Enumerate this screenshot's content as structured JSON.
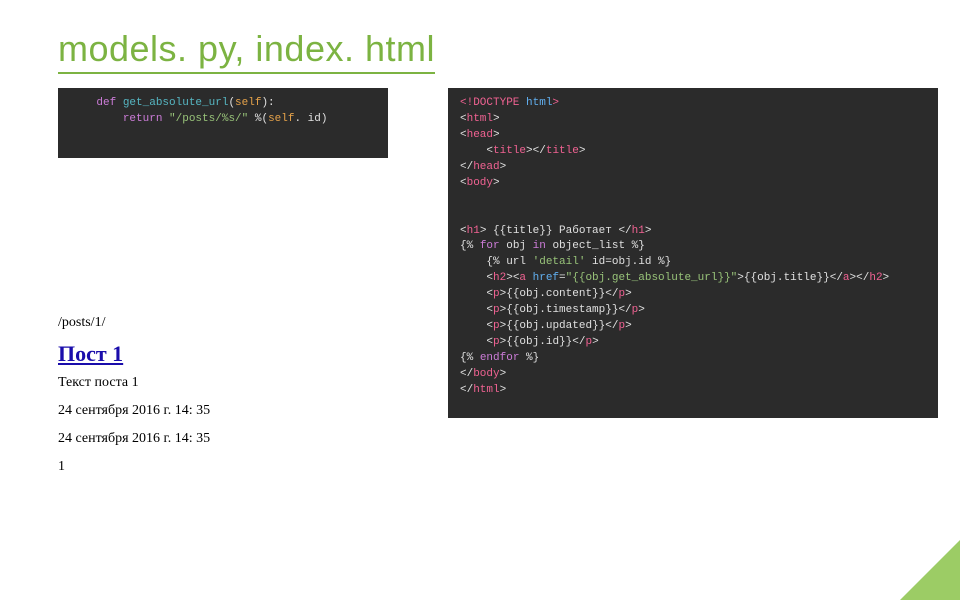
{
  "title": "models. py, index. html",
  "code_left": {
    "tokens": [
      {
        "t": "    ",
        "c": ""
      },
      {
        "t": "def ",
        "c": "kw-purple"
      },
      {
        "t": "get_absolute_url",
        "c": "kw-cyan"
      },
      {
        "t": "(",
        "c": "kw-white"
      },
      {
        "t": "self",
        "c": "kw-orange"
      },
      {
        "t": "):",
        "c": "kw-white"
      },
      {
        "t": "\n",
        "c": ""
      },
      {
        "t": "        ",
        "c": ""
      },
      {
        "t": "return ",
        "c": "kw-purple"
      },
      {
        "t": "\"/posts/%s/\"",
        "c": "kw-green"
      },
      {
        "t": " %(",
        "c": "kw-white"
      },
      {
        "t": "self",
        "c": "kw-orange"
      },
      {
        "t": ". id)",
        "c": "kw-white"
      }
    ]
  },
  "code_right": {
    "tokens": [
      {
        "t": "<!DOCTYPE ",
        "c": "kw-pink"
      },
      {
        "t": "html",
        "c": "kw-lightblue"
      },
      {
        "t": ">",
        "c": "kw-pink"
      },
      {
        "t": "\n",
        "c": ""
      },
      {
        "t": "<",
        "c": "kw-white"
      },
      {
        "t": "html",
        "c": "kw-pink"
      },
      {
        "t": ">",
        "c": "kw-white"
      },
      {
        "t": "\n",
        "c": ""
      },
      {
        "t": "<",
        "c": "kw-white"
      },
      {
        "t": "head",
        "c": "kw-pink"
      },
      {
        "t": ">",
        "c": "kw-white"
      },
      {
        "t": "\n",
        "c": ""
      },
      {
        "t": "    <",
        "c": "kw-white"
      },
      {
        "t": "title",
        "c": "kw-pink"
      },
      {
        "t": "></",
        "c": "kw-white"
      },
      {
        "t": "title",
        "c": "kw-pink"
      },
      {
        "t": ">",
        "c": "kw-white"
      },
      {
        "t": "\n",
        "c": ""
      },
      {
        "t": "</",
        "c": "kw-white"
      },
      {
        "t": "head",
        "c": "kw-pink"
      },
      {
        "t": ">",
        "c": "kw-white"
      },
      {
        "t": "\n",
        "c": ""
      },
      {
        "t": "<",
        "c": "kw-white"
      },
      {
        "t": "body",
        "c": "kw-pink"
      },
      {
        "t": ">",
        "c": "kw-white"
      },
      {
        "t": "\n\n\n",
        "c": ""
      },
      {
        "t": "<",
        "c": "kw-white"
      },
      {
        "t": "h1",
        "c": "kw-pink"
      },
      {
        "t": "> ",
        "c": "kw-white"
      },
      {
        "t": "{{title}}",
        "c": "kw-white"
      },
      {
        "t": " Работает ",
        "c": "kw-white"
      },
      {
        "t": "</",
        "c": "kw-white"
      },
      {
        "t": "h1",
        "c": "kw-pink"
      },
      {
        "t": ">",
        "c": "kw-white"
      },
      {
        "t": "\n",
        "c": ""
      },
      {
        "t": "{% ",
        "c": "kw-white"
      },
      {
        "t": "for",
        "c": "kw-purple"
      },
      {
        "t": " obj ",
        "c": "kw-white"
      },
      {
        "t": "in",
        "c": "kw-purple"
      },
      {
        "t": " object_list %}",
        "c": "kw-white"
      },
      {
        "t": "\n",
        "c": ""
      },
      {
        "t": "    {% url ",
        "c": "kw-white"
      },
      {
        "t": "'detail'",
        "c": "kw-green"
      },
      {
        "t": " id=obj.id %}",
        "c": "kw-white"
      },
      {
        "t": "\n",
        "c": ""
      },
      {
        "t": "    <",
        "c": "kw-white"
      },
      {
        "t": "h2",
        "c": "kw-pink"
      },
      {
        "t": "><",
        "c": "kw-white"
      },
      {
        "t": "a ",
        "c": "kw-pink"
      },
      {
        "t": "href",
        "c": "kw-lightblue"
      },
      {
        "t": "=",
        "c": "kw-white"
      },
      {
        "t": "\"{{obj.get_absolute_url}}\"",
        "c": "kw-green"
      },
      {
        "t": ">",
        "c": "kw-white"
      },
      {
        "t": "{{obj.title}}",
        "c": "kw-white"
      },
      {
        "t": "</",
        "c": "kw-white"
      },
      {
        "t": "a",
        "c": "kw-pink"
      },
      {
        "t": "></",
        "c": "kw-white"
      },
      {
        "t": "h2",
        "c": "kw-pink"
      },
      {
        "t": ">",
        "c": "kw-white"
      },
      {
        "t": "\n",
        "c": ""
      },
      {
        "t": "    <",
        "c": "kw-white"
      },
      {
        "t": "p",
        "c": "kw-pink"
      },
      {
        "t": ">",
        "c": "kw-white"
      },
      {
        "t": "{{obj.content}}",
        "c": "kw-white"
      },
      {
        "t": "</",
        "c": "kw-white"
      },
      {
        "t": "p",
        "c": "kw-pink"
      },
      {
        "t": ">",
        "c": "kw-white"
      },
      {
        "t": "\n",
        "c": ""
      },
      {
        "t": "    <",
        "c": "kw-white"
      },
      {
        "t": "p",
        "c": "kw-pink"
      },
      {
        "t": ">",
        "c": "kw-white"
      },
      {
        "t": "{{obj.timestamp}}",
        "c": "kw-white"
      },
      {
        "t": "</",
        "c": "kw-white"
      },
      {
        "t": "p",
        "c": "kw-pink"
      },
      {
        "t": ">",
        "c": "kw-white"
      },
      {
        "t": "\n",
        "c": ""
      },
      {
        "t": "    <",
        "c": "kw-white"
      },
      {
        "t": "p",
        "c": "kw-pink"
      },
      {
        "t": ">",
        "c": "kw-white"
      },
      {
        "t": "{{obj.updated}}",
        "c": "kw-white"
      },
      {
        "t": "</",
        "c": "kw-white"
      },
      {
        "t": "p",
        "c": "kw-pink"
      },
      {
        "t": ">",
        "c": "kw-white"
      },
      {
        "t": "\n",
        "c": ""
      },
      {
        "t": "    <",
        "c": "kw-white"
      },
      {
        "t": "p",
        "c": "kw-pink"
      },
      {
        "t": ">",
        "c": "kw-white"
      },
      {
        "t": "{{obj.id}}",
        "c": "kw-white"
      },
      {
        "t": "</",
        "c": "kw-white"
      },
      {
        "t": "p",
        "c": "kw-pink"
      },
      {
        "t": ">",
        "c": "kw-white"
      },
      {
        "t": "\n",
        "c": ""
      },
      {
        "t": "{% ",
        "c": "kw-white"
      },
      {
        "t": "endfor",
        "c": "kw-purple"
      },
      {
        "t": " %}",
        "c": "kw-white"
      },
      {
        "t": "\n",
        "c": ""
      },
      {
        "t": "</",
        "c": "kw-white"
      },
      {
        "t": "body",
        "c": "kw-pink"
      },
      {
        "t": ">",
        "c": "kw-white"
      },
      {
        "t": "\n",
        "c": ""
      },
      {
        "t": "</",
        "c": "kw-white"
      },
      {
        "t": "html",
        "c": "kw-pink"
      },
      {
        "t": ">",
        "c": "kw-white"
      }
    ]
  },
  "rendered": {
    "url": "/posts/1/",
    "heading": "Пост 1",
    "lines": [
      "Текст поста 1",
      "24 сентября 2016 г. 14: 35",
      "24 сентября 2016 г. 14: 35",
      "1"
    ]
  }
}
